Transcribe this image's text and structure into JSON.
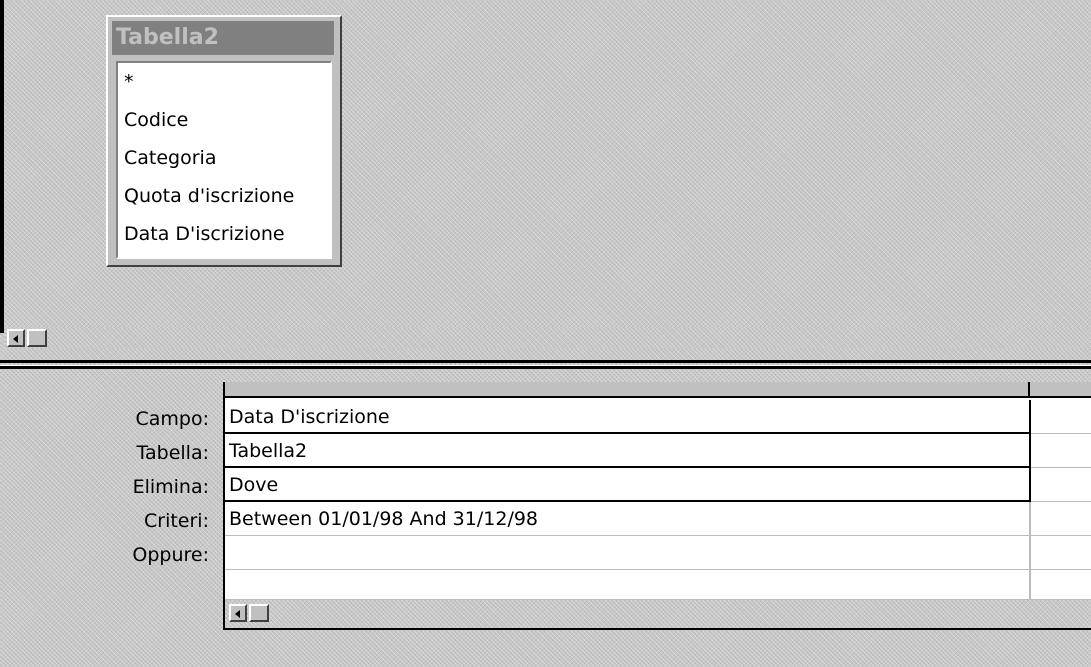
{
  "query_table": {
    "title": "Tabella2",
    "fields": [
      "*",
      "Codice",
      "Categoria",
      "Quota d'iscrizione",
      "Data D'iscrizione"
    ]
  },
  "grid": {
    "row_labels": [
      "Campo:",
      "Tabella:",
      "Elimina:",
      "Criteri:",
      "Oppure:"
    ],
    "column1": {
      "campo": "Data D'iscrizione",
      "tabella": "Tabella2",
      "elimina": "Dove",
      "criteri": "Between 01/01/98 And 31/12/98",
      "oppure": ""
    }
  },
  "icons": {
    "scroll_left": "scroll-left-arrow-icon"
  }
}
